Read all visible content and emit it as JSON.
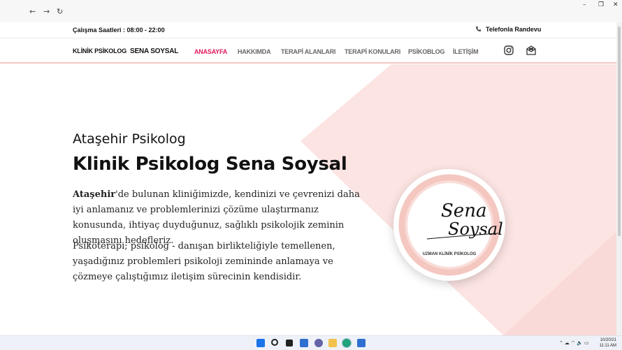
{
  "browser": {
    "back_icon": "arrow-left-icon",
    "forward_icon": "arrow-right-icon",
    "reload_icon": "reload-icon",
    "back_glyph": "←",
    "forward_glyph": "→",
    "reload_glyph": "↻",
    "window_controls": [
      "–",
      "❐",
      "✕"
    ]
  },
  "topbar": {
    "hours": "Çalışma Saatleri : 08:00 - 22:00",
    "phone_label": "Telefonla Randevu"
  },
  "header": {
    "brand_prefix": "KLİNİK PSİKOLOG",
    "brand_name": "SENA SOYSAL",
    "menu": [
      {
        "label": "ANASAYFA",
        "active": true
      },
      {
        "label": "HAKKIMDA",
        "active": false
      },
      {
        "label": "TERAPİ ALANLARI",
        "active": false
      },
      {
        "label": "TERAPİ KONULARI",
        "active": false
      },
      {
        "label": "PSİKOBLOG",
        "active": false
      },
      {
        "label": "İLETİŞİM",
        "active": false
      }
    ]
  },
  "hero": {
    "subtitle": "Ataşehir Psikolog",
    "title": "Klinik Psikolog Sena Soysal",
    "p1_bold": "Ataşehir",
    "p1_rest": "'de bulunan kliniğimizde, kendinizi ve çevrenizi daha iyi anlamanız ve problemlerinizi çözüme ulaştırmanız konusunda, ihtiyaç duyduğunuz, sağlıklı psikolojik zeminin oluşmasını hedefleriz.",
    "p2": "Psikoterapi; psikolog - danışan birlikteliğiyle temellenen, yaşadığınız problemleri psikoloji zemininde anlamaya ve çözmeye çalıştığımız iletişim sürecinin kendisidir."
  },
  "logo": {
    "script_line1": "Sena",
    "script_line2": "Soysal",
    "caption": "UZMAN KLİNİK PSİKOLOG"
  },
  "taskbar": {
    "time": "11:11 AM",
    "date": "10/20/21",
    "tray": "⌃  ☁  ⌔  🔈 ▭"
  },
  "colors": {
    "accent": "#e2185b",
    "pink_bg": "#fce4e3",
    "nav_border": "#f3c6c2"
  }
}
